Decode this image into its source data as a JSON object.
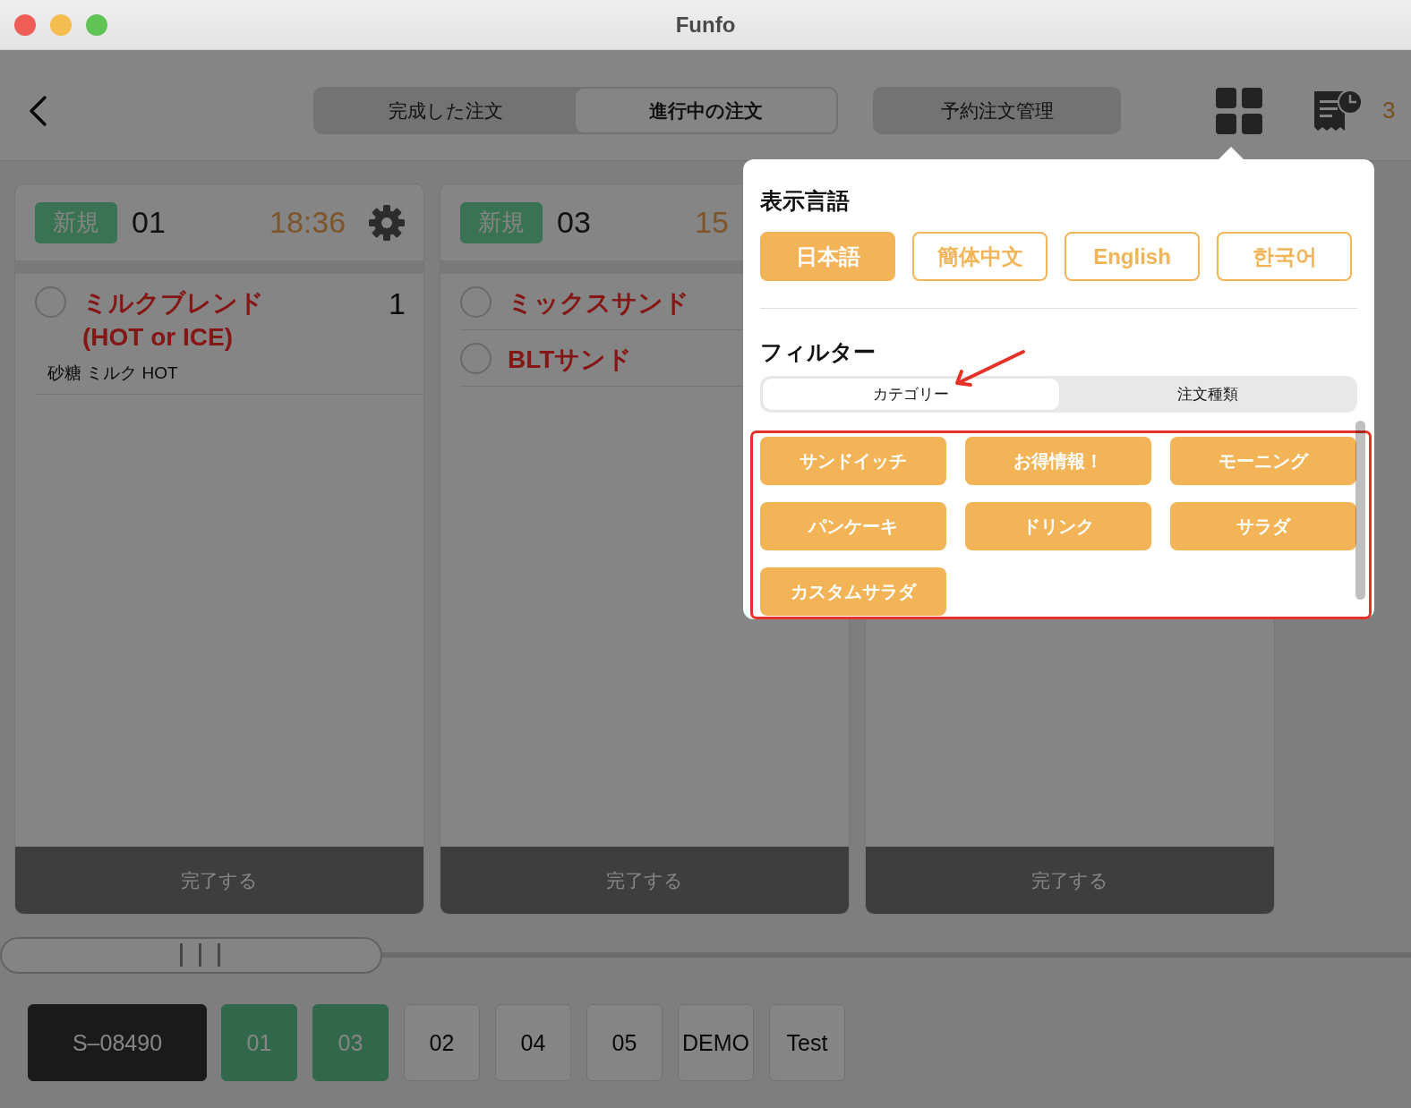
{
  "window": {
    "title": "Funfo"
  },
  "header": {
    "tabs": [
      {
        "label": "完成した注文",
        "selected": false
      },
      {
        "label": "進行中の注文",
        "selected": true
      }
    ],
    "reservation_button": "予約注文管理",
    "receipt_count": "3"
  },
  "orders": [
    {
      "badge": "新規",
      "number": "01",
      "time": "18:36",
      "settings": true,
      "items": [
        {
          "name": "ミルクブレンド\n(HOT or ICE)",
          "quantity": "1",
          "options": "砂糖 ミルク HOT",
          "checked": false
        }
      ],
      "complete_label": "完了する"
    },
    {
      "badge": "新規",
      "number": "03",
      "time": "15",
      "items": [
        {
          "name": "ミックスサンド",
          "checked": false
        },
        {
          "name": "BLTサンド",
          "checked": false
        }
      ],
      "complete_label": "完了する"
    },
    {
      "complete_label": "完了する"
    }
  ],
  "tables": [
    {
      "label": "S–08490",
      "kind": "code"
    },
    {
      "label": "01",
      "kind": "table",
      "occupied": true
    },
    {
      "label": "03",
      "kind": "table",
      "occupied": true
    },
    {
      "label": "02",
      "kind": "table",
      "occupied": false
    },
    {
      "label": "04",
      "kind": "table",
      "occupied": false
    },
    {
      "label": "05",
      "kind": "table",
      "occupied": false
    },
    {
      "label": "DEMO",
      "kind": "table",
      "occupied": false
    },
    {
      "label": "Test",
      "kind": "table",
      "occupied": false
    }
  ],
  "popover": {
    "language_title": "表示言語",
    "languages": [
      {
        "label": "日本語",
        "selected": true
      },
      {
        "label": "簡体中文",
        "selected": false
      },
      {
        "label": "English",
        "selected": false
      },
      {
        "label": "한국어",
        "selected": false
      }
    ],
    "filter_title": "フィルター",
    "filter_tabs": [
      {
        "label": "カテゴリー",
        "selected": true
      },
      {
        "label": "注文種類",
        "selected": false
      }
    ],
    "categories": [
      "サンドイッチ",
      "お得情報！",
      "モーニング",
      "パンケーキ",
      "ドリンク",
      "サラダ",
      "カスタムサラダ"
    ]
  }
}
